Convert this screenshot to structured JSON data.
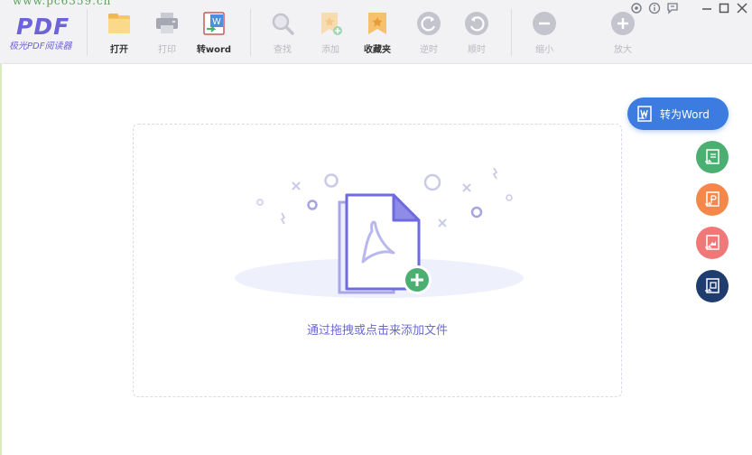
{
  "app": {
    "watermark": "www.pc6359.cn",
    "logo_main": "PDF",
    "logo_sub": "极光PDF阅读器"
  },
  "toolbar": {
    "open": "打开",
    "print": "打印",
    "to_word": "转word",
    "find": "查找",
    "add": "添加",
    "favorites": "收藏夹",
    "rotate_ccw": "逆时",
    "rotate_cw": "顺时",
    "zoom_out": "缩小",
    "zoom_in": "放大"
  },
  "main": {
    "drop_hint": "通过拖拽或点击来添加文件"
  },
  "side": {
    "convert_word": "转为Word"
  },
  "colors": {
    "accent": "#6b69d6",
    "word_blue": "#3c7be0",
    "excel_green": "#4caf72",
    "ppt_orange": "#f5874a",
    "img_red": "#f07878",
    "dark_navy": "#1f3c6e"
  }
}
